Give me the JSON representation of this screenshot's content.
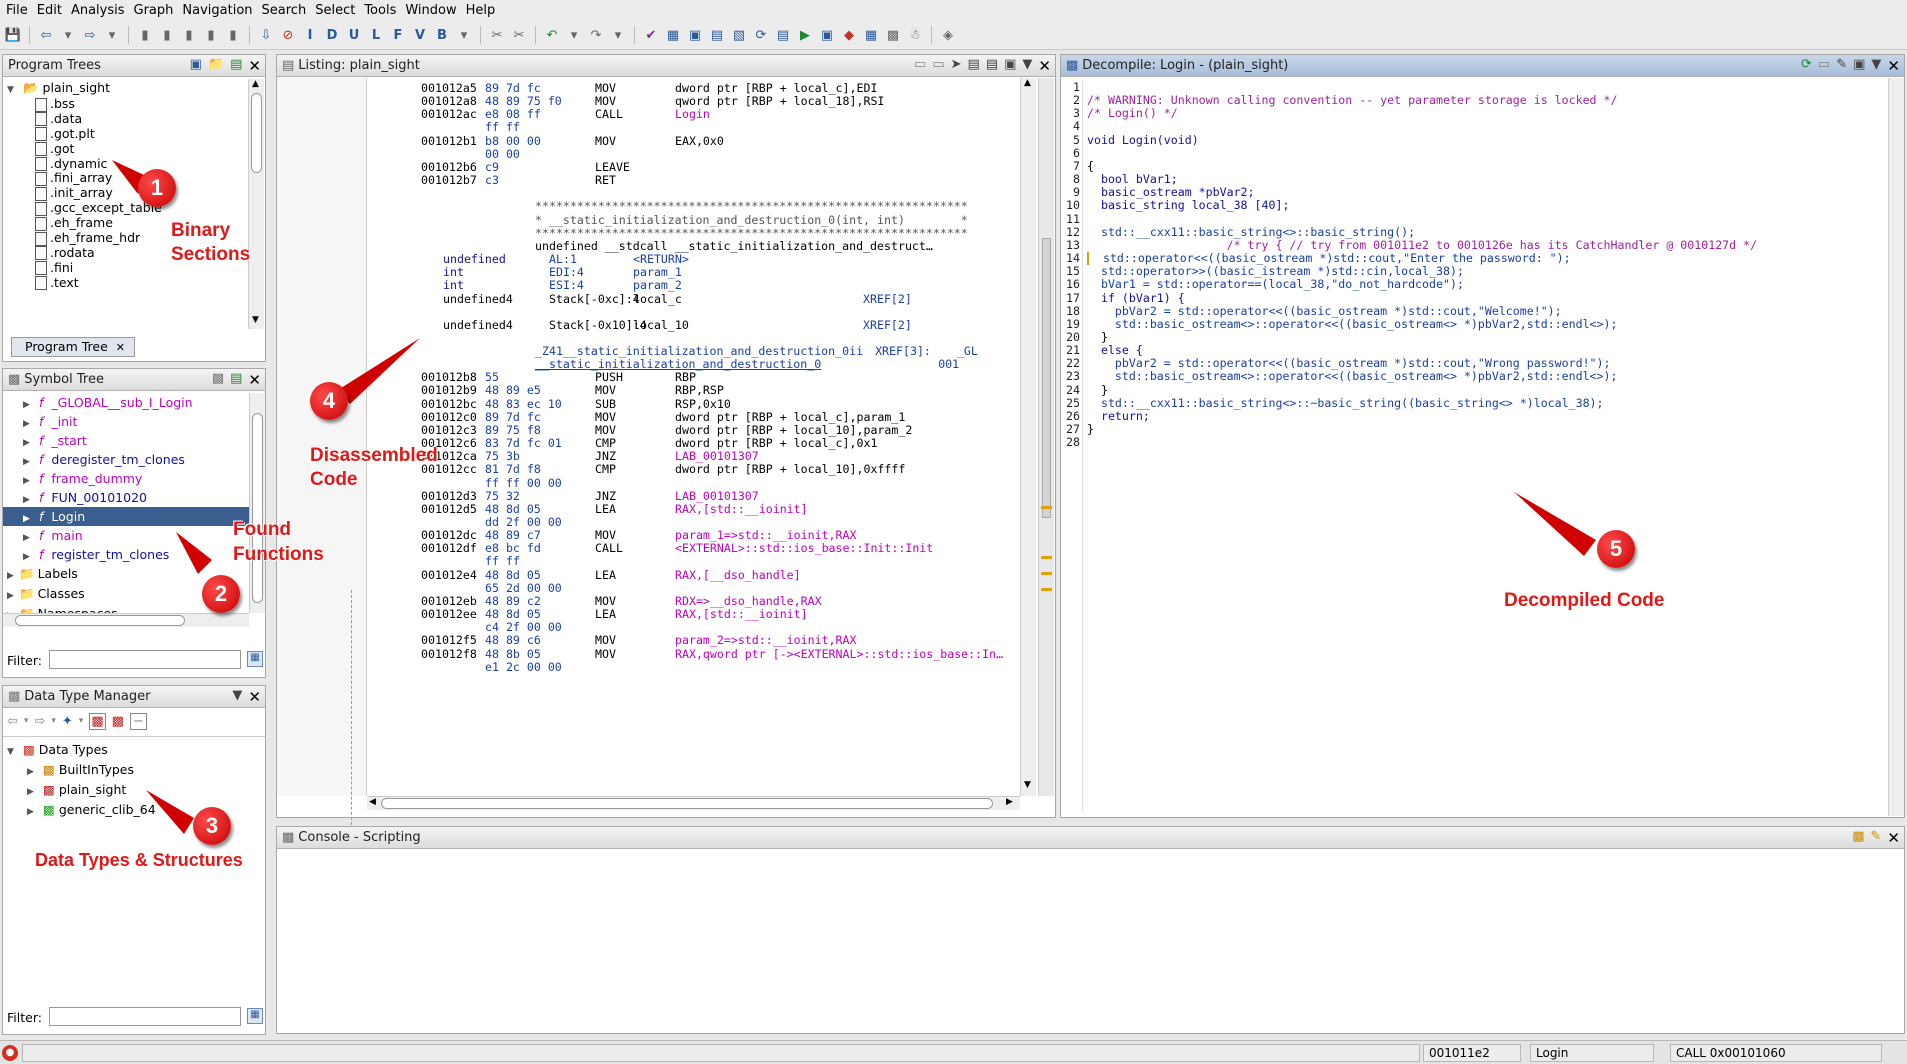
{
  "menu": [
    "File",
    "Edit",
    "Analysis",
    "Graph",
    "Navigation",
    "Search",
    "Select",
    "Tools",
    "Window",
    "Help"
  ],
  "program_trees": {
    "title": "Program Trees",
    "root": "plain_sight",
    "sections": [
      ".bss",
      ".data",
      ".got.plt",
      ".got",
      ".dynamic",
      ".fini_array",
      ".init_array",
      ".gcc_except_table",
      ".eh_frame",
      ".eh_frame_hdr",
      ".rodata",
      ".fini",
      ".text"
    ],
    "tab": "Program Tree"
  },
  "symbol_tree": {
    "title": "Symbol Tree",
    "functions": [
      "_GLOBAL__sub_I_Login",
      "_init",
      "_start",
      "deregister_tm_clones",
      "frame_dummy",
      "FUN_00101020",
      "Login",
      "main",
      "register_tm_clones"
    ],
    "selected": "Login",
    "folders": [
      "Labels",
      "Classes",
      "Namespaces"
    ],
    "filter_label": "Filter:"
  },
  "data_type_manager": {
    "title": "Data Type Manager",
    "root": "Data Types",
    "items": [
      "BuiltInTypes",
      "plain_sight",
      "generic_clib_64"
    ],
    "filter_label": "Filter:"
  },
  "listing": {
    "title": "Listing:  plain_sight",
    "lines": [
      {
        "a": "001012a5",
        "b": "89 7d fc",
        "m": "MOV",
        "o": "dword ptr [RBP + local_c],EDI"
      },
      {
        "a": "001012a8",
        "b": "48 89 75 f0",
        "m": "MOV",
        "o": "qword ptr [RBP + local_18],RSI"
      },
      {
        "a": "001012ac",
        "b": "e8 08 ff",
        "m": "CALL",
        "o": "Login"
      },
      {
        "a": "",
        "b": "ff ff",
        "m": "",
        "o": ""
      },
      {
        "a": "001012b1",
        "b": "b8 00 00",
        "m": "MOV",
        "o": "EAX,0x0"
      },
      {
        "a": "",
        "b": "00 00",
        "m": "",
        "o": ""
      },
      {
        "a": "001012b6",
        "b": "c9",
        "m": "LEAVE",
        "o": ""
      },
      {
        "a": "001012b7",
        "b": "c3",
        "m": "RET",
        "o": ""
      }
    ],
    "header_block": [
      "**************************************************************",
      "* __static_initialization_and_destruction_0(int, int)        *",
      "**************************************************************",
      "undefined __stdcall __static_initialization_and_destruct…"
    ],
    "params": [
      {
        "t": "undefined",
        "r": "AL:1",
        "n": "<RETURN>",
        "x": ""
      },
      {
        "t": "int",
        "r": "EDI:4",
        "n": "param_1",
        "x": ""
      },
      {
        "t": "int",
        "r": "ESI:4",
        "n": "param_2",
        "x": ""
      },
      {
        "t": "undefined4",
        "r": "Stack[-0xc]:4",
        "n": "local_c",
        "x": "XREF[2]"
      },
      {
        "t": "undefined4",
        "r": "Stack[-0x10]:4",
        "n": "local_10",
        "x": "XREF[2]"
      }
    ],
    "fn_label_1": "_Z41__static_initialization_and_destruction_0ii",
    "fn_xref": "XREF[3]:",
    "fn_xref_2a": "_GL",
    "fn_xref_2b": "001",
    "fn_label_2": "__static_initialization_and_destruction_0",
    "lines2": [
      {
        "a": "001012b8",
        "b": "55",
        "m": "PUSH",
        "o": "RBP"
      },
      {
        "a": "001012b9",
        "b": "48 89 e5",
        "m": "MOV",
        "o": "RBP,RSP"
      },
      {
        "a": "001012bc",
        "b": "48 83 ec 10",
        "m": "SUB",
        "o": "RSP,0x10"
      },
      {
        "a": "001012c0",
        "b": "89 7d fc",
        "m": "MOV",
        "o": "dword ptr [RBP + local_c],param_1"
      },
      {
        "a": "001012c3",
        "b": "89 75 f8",
        "m": "MOV",
        "o": "dword ptr [RBP + local_10],param_2"
      },
      {
        "a": "001012c6",
        "b": "83 7d fc 01",
        "m": "CMP",
        "o": "dword ptr [RBP + local_c],0x1"
      },
      {
        "a": "001012ca",
        "b": "75 3b",
        "m": "JNZ",
        "o": "LAB_00101307"
      },
      {
        "a": "001012cc",
        "b": "81 7d f8",
        "m": "CMP",
        "o": "dword ptr [RBP + local_10],0xffff"
      },
      {
        "a": "",
        "b": "ff ff 00 00",
        "m": "",
        "o": ""
      },
      {
        "a": "001012d3",
        "b": "75 32",
        "m": "JNZ",
        "o": "LAB_00101307"
      },
      {
        "a": "001012d5",
        "b": "48 8d 05",
        "m": "LEA",
        "o": "RAX,[std::__ioinit]"
      },
      {
        "a": "",
        "b": "dd 2f 00 00",
        "m": "",
        "o": ""
      },
      {
        "a": "001012dc",
        "b": "48 89 c7",
        "m": "MOV",
        "o": "param_1=>std::__ioinit,RAX"
      },
      {
        "a": "001012df",
        "b": "e8 bc fd",
        "m": "CALL",
        "o": "<EXTERNAL>::std::ios_base::Init::Init"
      },
      {
        "a": "",
        "b": "ff ff",
        "m": "",
        "o": ""
      },
      {
        "a": "001012e4",
        "b": "48 8d 05",
        "m": "LEA",
        "o": "RAX,[__dso_handle]"
      },
      {
        "a": "",
        "b": "65 2d 00 00",
        "m": "",
        "o": ""
      },
      {
        "a": "001012eb",
        "b": "48 89 c2",
        "m": "MOV",
        "o": "RDX=>__dso_handle,RAX"
      },
      {
        "a": "001012ee",
        "b": "48 8d 05",
        "m": "LEA",
        "o": "RAX,[std::__ioinit]"
      },
      {
        "a": "",
        "b": "c4 2f 00 00",
        "m": "",
        "o": ""
      },
      {
        "a": "001012f5",
        "b": "48 89 c6",
        "m": "MOV",
        "o": "param_2=>std::__ioinit,RAX"
      },
      {
        "a": "001012f8",
        "b": "48 8b 05",
        "m": "MOV",
        "o": "RAX,qword ptr [-><EXTERNAL>::std::ios_base::In…"
      },
      {
        "a": "",
        "b": "e1 2c 00 00",
        "m": "",
        "o": ""
      }
    ]
  },
  "decompile": {
    "title": "Decompile: Login -  (plain_sight)",
    "lines": [
      "",
      "/* WARNING: Unknown calling convention -- yet parameter storage is locked */",
      "/* Login() */",
      "",
      "void Login(void)",
      "",
      "{",
      "  bool bVar1;",
      "  basic_ostream *pbVar2;",
      "  basic_string local_38 [40];",
      "",
      "  std::__cxx11::basic_string<>::basic_string();",
      "                    /* try { // try from 001011e2 to 0010126e has its CatchHandler @ 0010127d */",
      "  std::operator<<((basic_ostream *)std::cout,\"Enter the password: \");",
      "  std::operator>>((basic_istream *)std::cin,local_38);",
      "  bVar1 = std::operator==(local_38,\"do_not_hardcode\");",
      "  if (bVar1) {",
      "    pbVar2 = std::operator<<((basic_ostream *)std::cout,\"Welcome!\");",
      "    std::basic_ostream<>::operator<<((basic_ostream<> *)pbVar2,std::endl<>);",
      "  }",
      "  else {",
      "    pbVar2 = std::operator<<((basic_ostream *)std::cout,\"Wrong password!\");",
      "    std::basic_ostream<>::operator<<((basic_ostream<> *)pbVar2,std::endl<>);",
      "  }",
      "  std::__cxx11::basic_string<>::~basic_string((basic_string<> *)local_38);",
      "  return;",
      "}",
      ""
    ]
  },
  "console": {
    "title": "Console - Scripting"
  },
  "status": {
    "address": "001011e2",
    "function": "Login",
    "instruction": "CALL 0x00101060"
  },
  "annotations": {
    "a1": {
      "num": "1",
      "text1": "Binary",
      "text2": "Sections"
    },
    "a2": {
      "num": "2",
      "text1": "Found",
      "text2": "Functions"
    },
    "a3": {
      "num": "3",
      "text1": "Data Types & Structures"
    },
    "a4": {
      "num": "4",
      "text1": "Disassembled",
      "text2": "Code"
    },
    "a5": {
      "num": "5",
      "text1": "Decompiled Code"
    }
  },
  "colors": {
    "annotation_red": "#e01818",
    "selection": "#3a5f8e",
    "label_magenta": "#c000c0",
    "bytes_blue": "#1a3ea8"
  }
}
